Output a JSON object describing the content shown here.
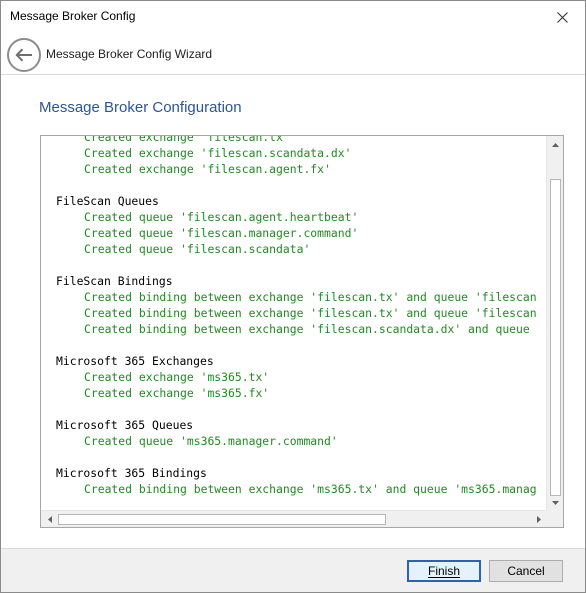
{
  "window": {
    "title": "Message Broker Config"
  },
  "wizard": {
    "title": "Message Broker Config Wizard"
  },
  "page": {
    "heading": "Message Broker Configuration"
  },
  "log": [
    {
      "type": "item",
      "text": "Created exchange 'filescan.tx'"
    },
    {
      "type": "item",
      "text": "Created exchange 'filescan.scandata.dx'"
    },
    {
      "type": "item",
      "text": "Created exchange 'filescan.agent.fx'"
    },
    {
      "type": "blank",
      "text": ""
    },
    {
      "type": "header",
      "text": "FileScan Queues"
    },
    {
      "type": "item",
      "text": "Created queue 'filescan.agent.heartbeat'"
    },
    {
      "type": "item",
      "text": "Created queue 'filescan.manager.command'"
    },
    {
      "type": "item",
      "text": "Created queue 'filescan.scandata'"
    },
    {
      "type": "blank",
      "text": ""
    },
    {
      "type": "header",
      "text": "FileScan Bindings"
    },
    {
      "type": "item",
      "text": "Created binding between exchange 'filescan.tx' and queue 'filescan"
    },
    {
      "type": "item",
      "text": "Created binding between exchange 'filescan.tx' and queue 'filescan"
    },
    {
      "type": "item",
      "text": "Created binding between exchange 'filescan.scandata.dx' and queue"
    },
    {
      "type": "blank",
      "text": ""
    },
    {
      "type": "header",
      "text": "Microsoft 365 Exchanges"
    },
    {
      "type": "item",
      "text": "Created exchange 'ms365.tx'"
    },
    {
      "type": "item",
      "text": "Created exchange 'ms365.fx'"
    },
    {
      "type": "blank",
      "text": ""
    },
    {
      "type": "header",
      "text": "Microsoft 365 Queues"
    },
    {
      "type": "item",
      "text": "Created queue 'ms365.manager.command'"
    },
    {
      "type": "blank",
      "text": ""
    },
    {
      "type": "header",
      "text": "Microsoft 365 Bindings"
    },
    {
      "type": "item",
      "text": "Created binding between exchange 'ms365.tx' and queue 'ms365.manag"
    }
  ],
  "buttons": {
    "finish": "Finish",
    "cancel": "Cancel"
  },
  "icons": {
    "close": "close-icon",
    "back": "back-arrow-icon"
  },
  "colors": {
    "heading": "#2a5699",
    "log_item": "#1f8c1f",
    "log_header": "#000000",
    "default_button_border": "#2a62b6"
  }
}
